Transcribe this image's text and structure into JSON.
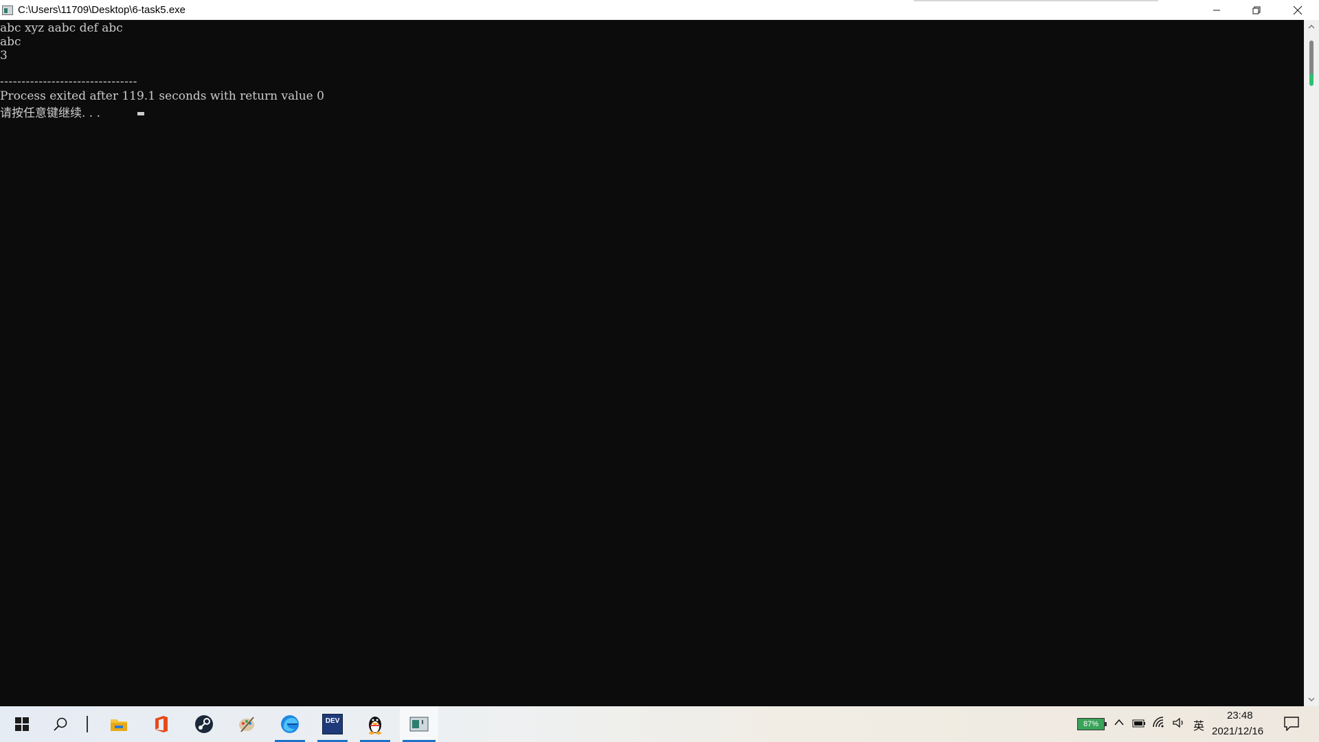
{
  "window": {
    "title": "C:\\Users\\11709\\Desktop\\6-task5.exe",
    "minimize": "—",
    "restore": "❐",
    "close": "✕"
  },
  "console": {
    "lines": [
      "abc xyz aabc def abc",
      "abc",
      "3",
      "",
      "--------------------------------",
      "Process exited after 119.1 seconds with return value 0",
      "请按任意键继续. . ."
    ]
  },
  "scrollbar": {
    "up_arrow": "▲",
    "down_arrow": "▼"
  },
  "taskbar": {
    "apps": [
      {
        "name": "file-explorer",
        "icon": "folder-icon"
      },
      {
        "name": "office",
        "icon": "office-icon"
      },
      {
        "name": "steam",
        "icon": "steam-icon"
      },
      {
        "name": "paint",
        "icon": "paint-icon"
      },
      {
        "name": "edge",
        "icon": "edge-icon",
        "active": true
      },
      {
        "name": "dev-cpp",
        "icon": "devcpp-icon",
        "label": "DEV",
        "active": true
      },
      {
        "name": "qq",
        "icon": "qq-penguin-icon",
        "active": true
      },
      {
        "name": "console",
        "icon": "console-app-icon",
        "active": true
      }
    ],
    "tray": {
      "battery": "87%",
      "chevron": "^",
      "ime": "英",
      "time": "23:48",
      "date": "2021/12/16"
    }
  }
}
